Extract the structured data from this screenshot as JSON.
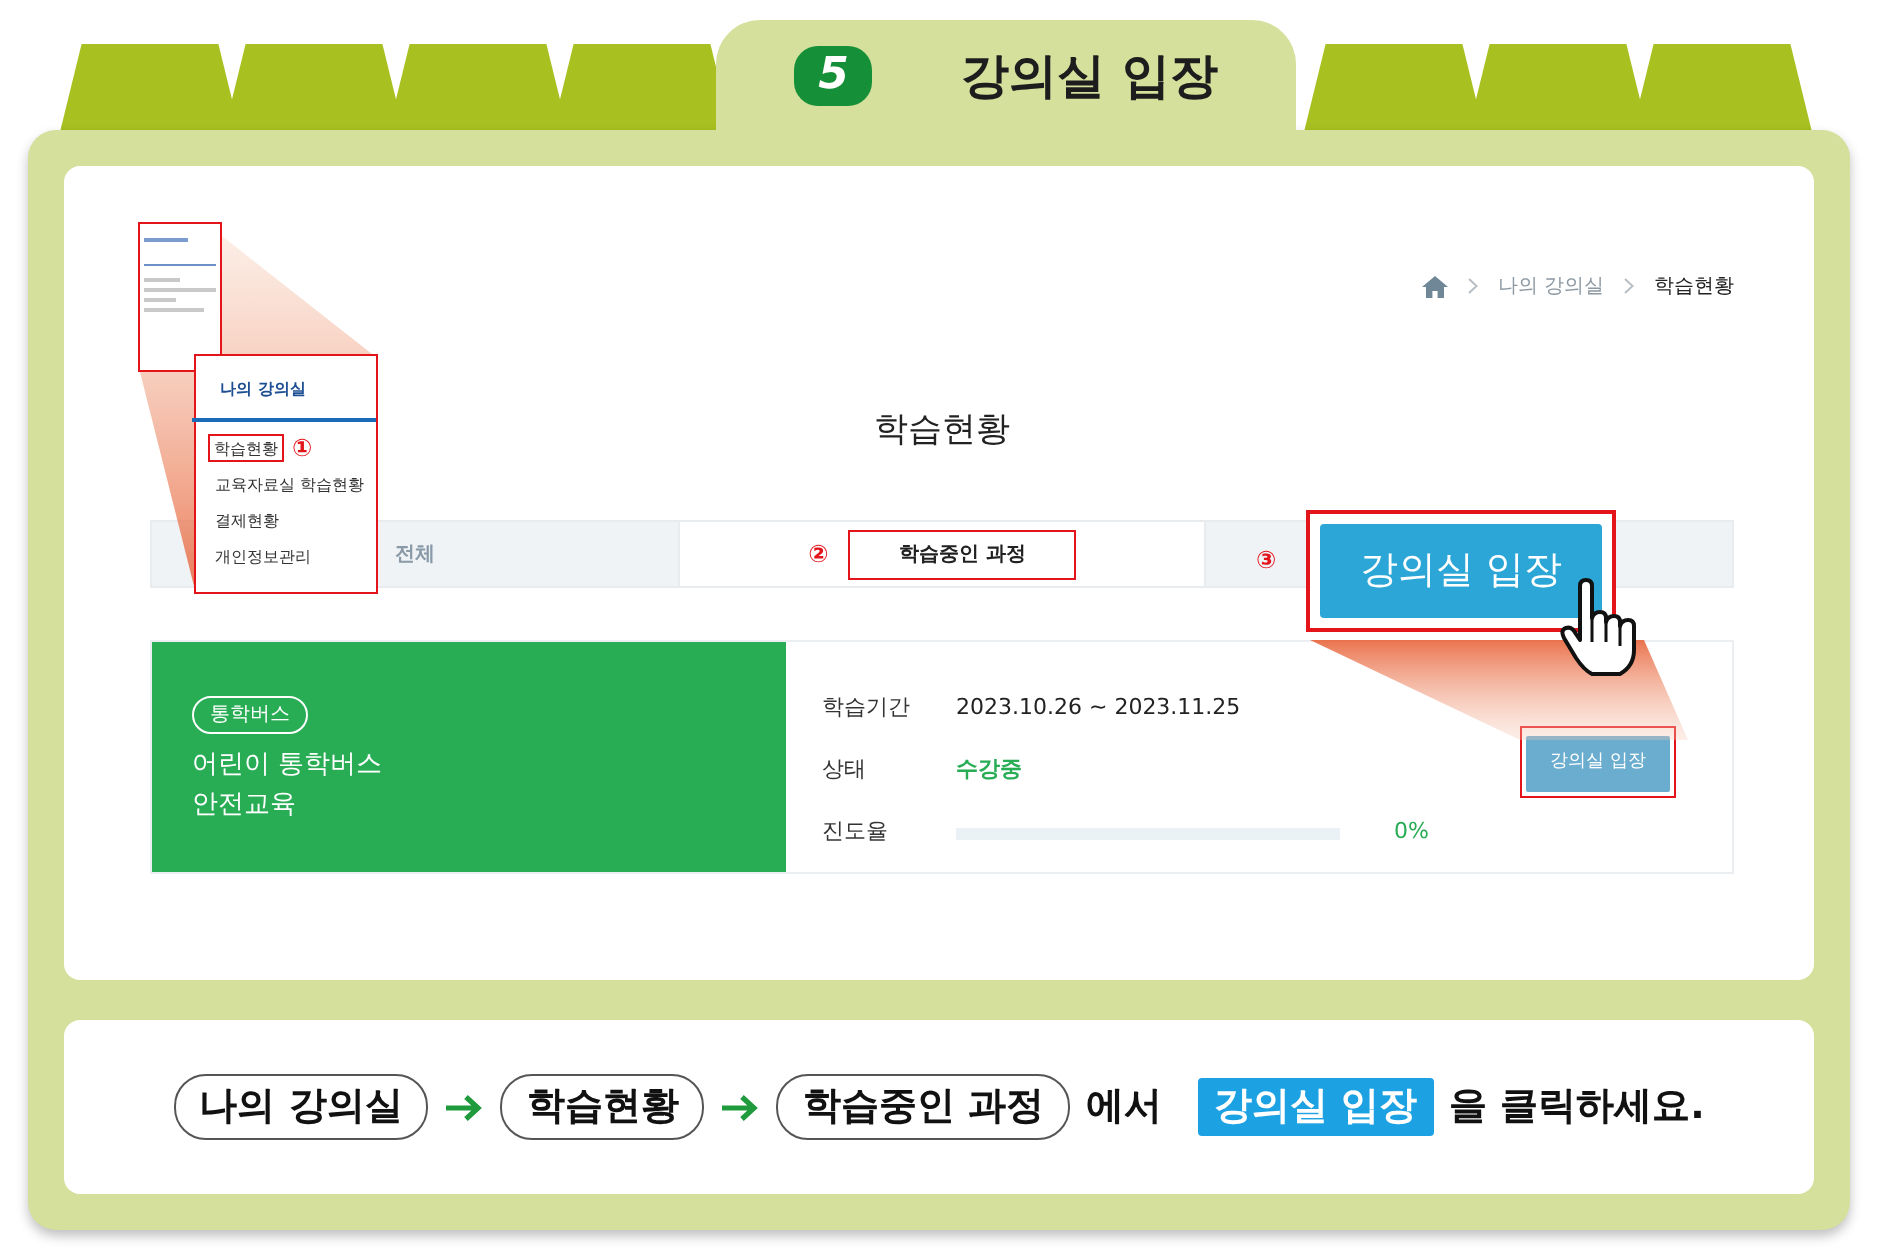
{
  "step": {
    "number": "5",
    "title": "강의실 입장"
  },
  "zoom_menu": {
    "title": "나의 강의실",
    "items": [
      {
        "label": "학습현황",
        "highlighted": true,
        "marker": "①"
      },
      {
        "label": "교육자료실 학습현황",
        "highlighted": false
      },
      {
        "label": "결제현황",
        "highlighted": false
      },
      {
        "label": "개인정보관리",
        "highlighted": false
      }
    ]
  },
  "breadcrumb": [
    "나의 강의실",
    "학습현황"
  ],
  "page_title": "학습현황",
  "tabs": [
    {
      "label": "전체",
      "selected": false,
      "highlighted": false
    },
    {
      "label": "학습중인 과정",
      "selected": true,
      "highlighted": true,
      "marker": "②"
    },
    {
      "selected": false,
      "highlighted": false
    }
  ],
  "zoom_button": {
    "label": "강의실 입장",
    "marker": "③"
  },
  "course": {
    "category": "통학버스",
    "title_lines": [
      "어린이 통학버스",
      "안전교육"
    ],
    "rows": [
      {
        "kind": "text",
        "label": "학습기간",
        "value": "2023.10.26 ~ 2023.11.25"
      },
      {
        "kind": "status",
        "label": "상태",
        "value": "수강중"
      },
      {
        "kind": "progress",
        "label": "진도율",
        "level": 0,
        "value": "0%"
      }
    ],
    "button": {
      "label": "강의실 입장",
      "highlighted": true
    }
  },
  "instruction": {
    "steps": [
      "나의 강의실",
      "학습현황",
      "학습중인 과정"
    ],
    "connector": "에서",
    "target": "강의실 입장",
    "suffix": "을 클릭하세요."
  }
}
